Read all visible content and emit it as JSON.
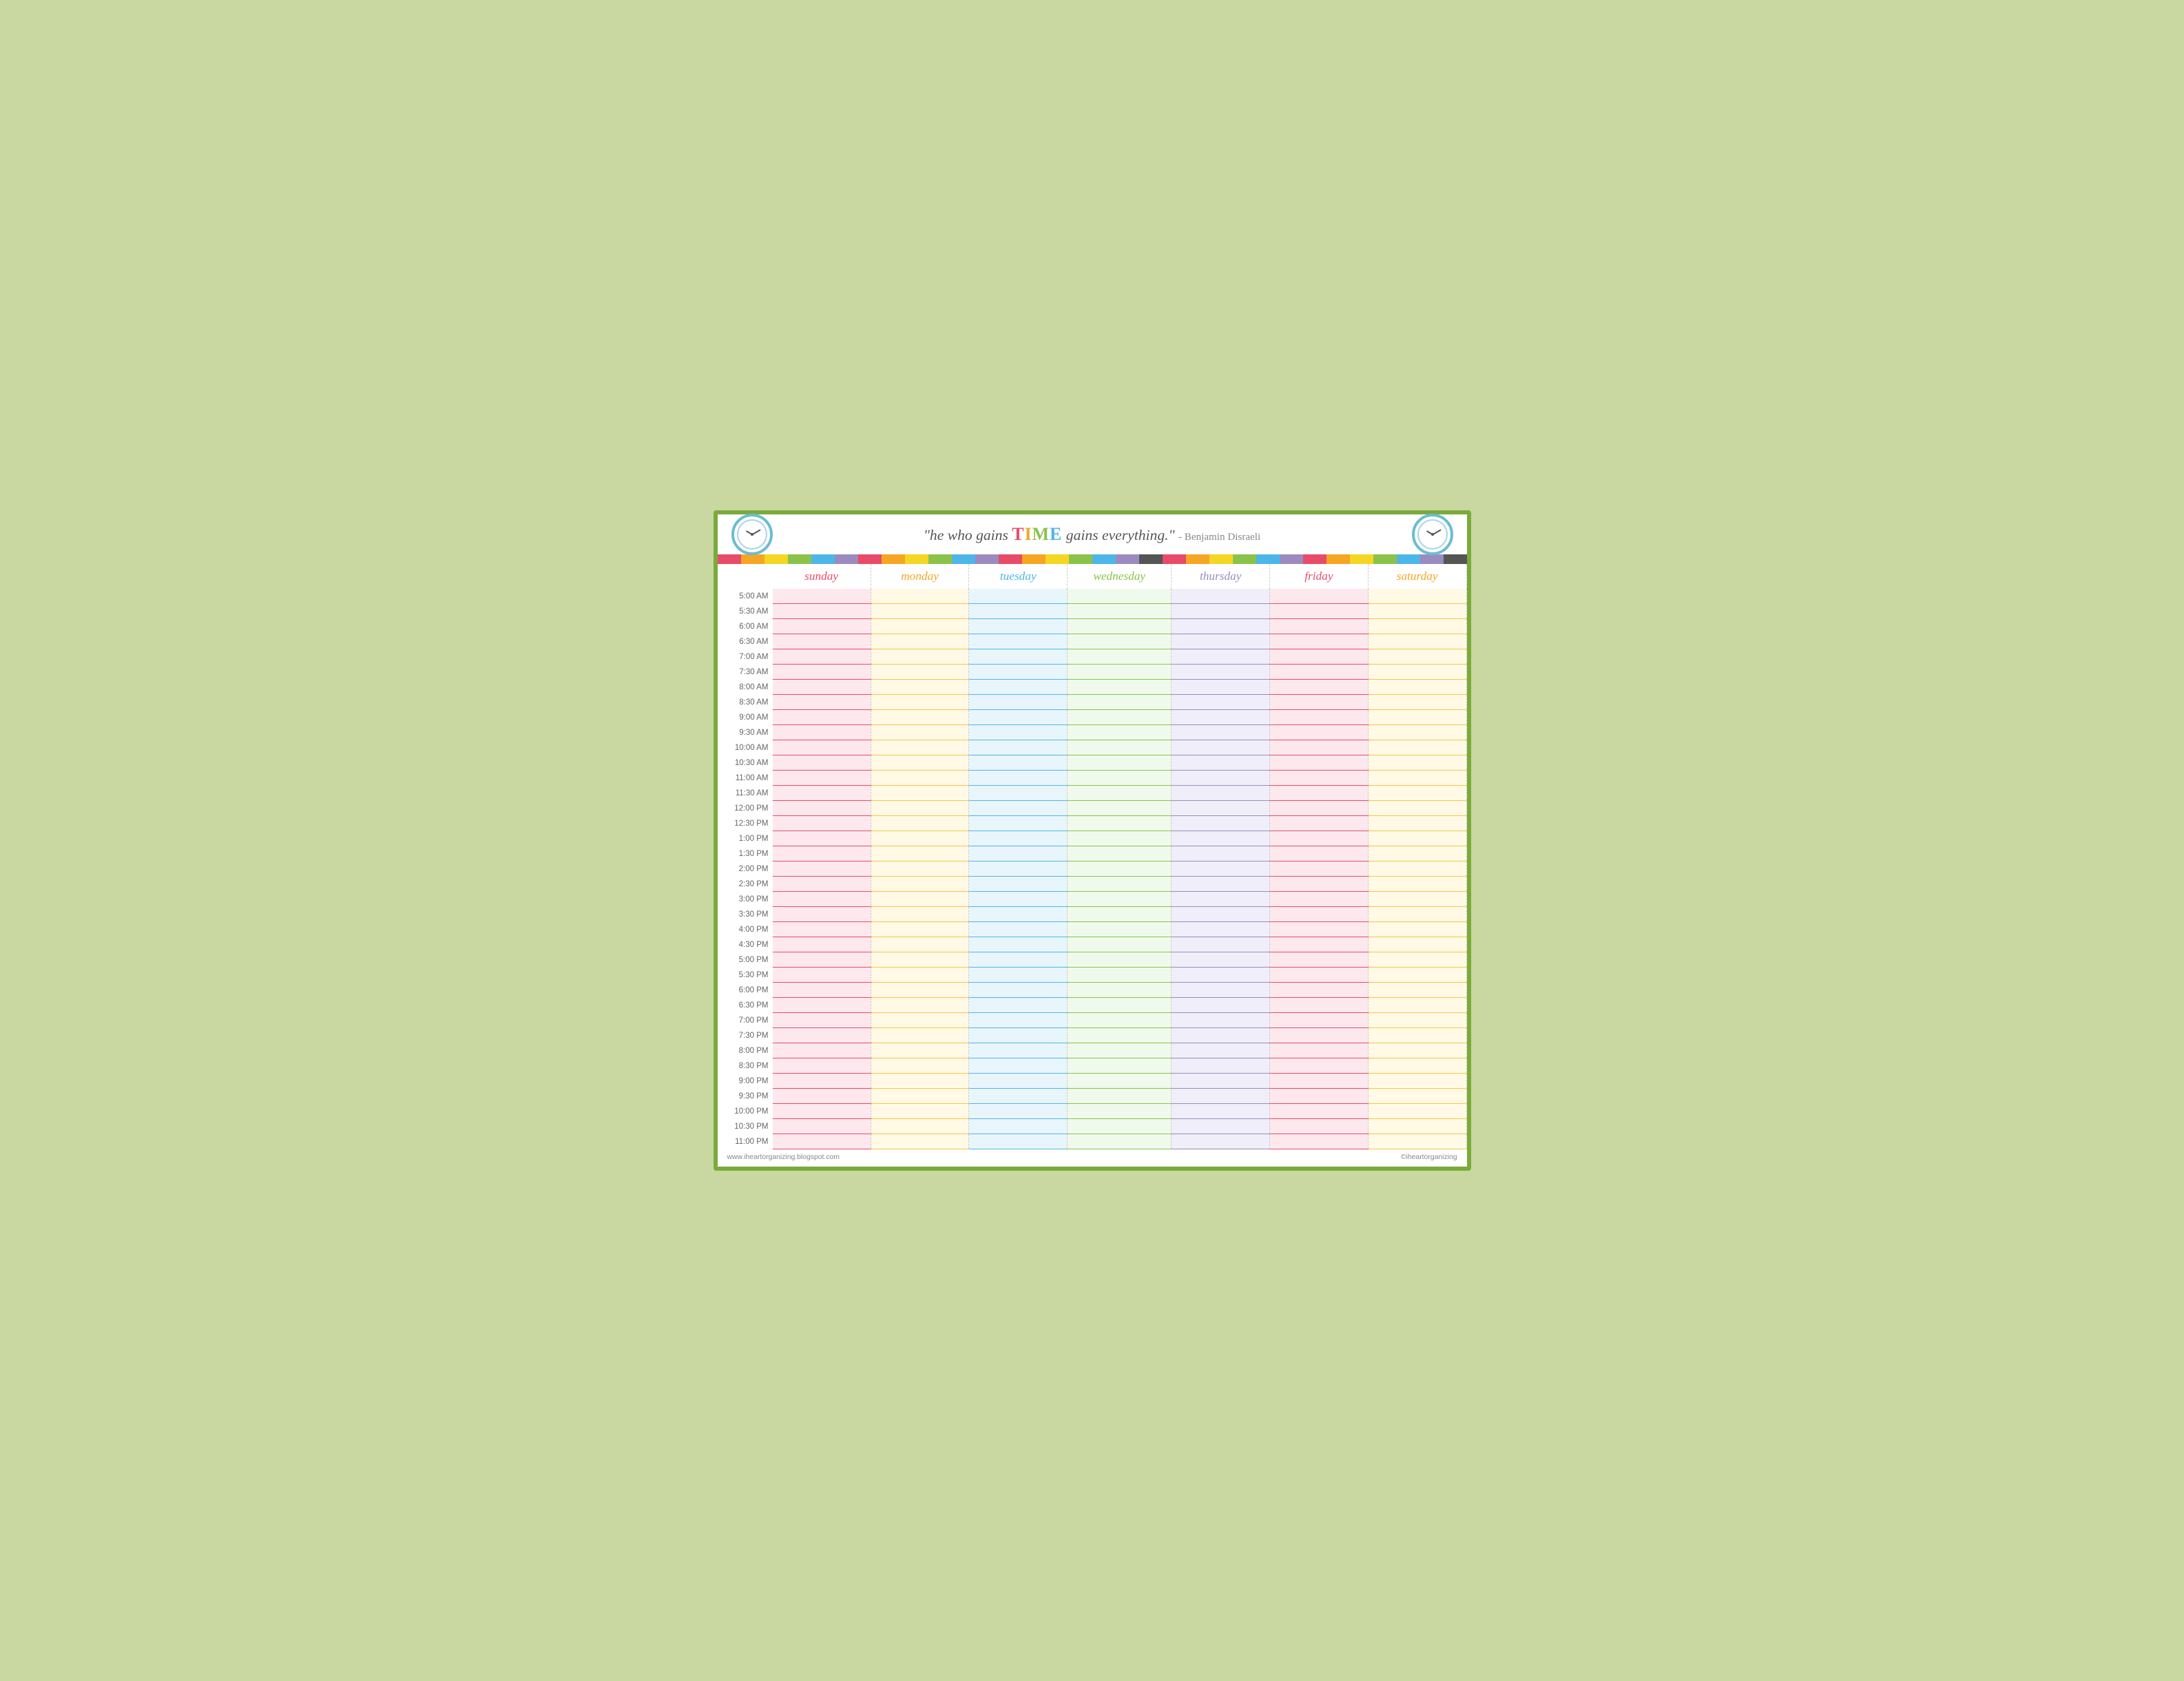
{
  "header": {
    "quote_before": "\"he who gains ",
    "quote_time": "TIME",
    "quote_after": " gains everything.\"",
    "attribution": "- Benjamin Disraeli"
  },
  "days": {
    "sunday": "sunday",
    "monday": "monday",
    "tuesday": "tuesday",
    "wednesday": "wednesday",
    "thursday": "thursday",
    "friday": "friday",
    "saturday": "saturday"
  },
  "times": [
    "5:00 AM",
    "5:30 AM",
    "6:00 AM",
    "6:30 AM",
    "7:00 AM",
    "7:30 AM",
    "8:00 AM",
    "8:30 AM",
    "9:00 AM",
    "9:30 AM",
    "10:00 AM",
    "10:30 AM",
    "11:00 AM",
    "11:30 AM",
    "12:00 PM",
    "12:30 PM",
    "1:00 PM",
    "1:30 PM",
    "2:00 PM",
    "2:30 PM",
    "3:00 PM",
    "3:30 PM",
    "4:00 PM",
    "4:30 PM",
    "5:00 PM",
    "5:30 PM",
    "6:00 PM",
    "6:30 PM",
    "7:00 PM",
    "7:30 PM",
    "8:00 PM",
    "8:30 PM",
    "9:00 PM",
    "9:30 PM",
    "10:00 PM",
    "10:30 PM",
    "11:00 PM"
  ],
  "rainbow_colors": [
    "#e84b6a",
    "#f5a623",
    "#f5d623",
    "#8bc34a",
    "#4db6e8",
    "#9b8bbf",
    "#e84b6a",
    "#f5a623",
    "#f5d623",
    "#8bc34a",
    "#4db6e8",
    "#9b8bbf",
    "#e84b6a",
    "#f5a623",
    "#f5d623",
    "#8bc34a",
    "#4db6e8",
    "#9b8bbf",
    "#555555",
    "#e84b6a",
    "#f5a623",
    "#f5d623",
    "#8bc34a",
    "#4db6e8",
    "#9b8bbf",
    "#e84b6a",
    "#f5a623",
    "#f5d623",
    "#8bc34a",
    "#4db6e8",
    "#9b8bbf",
    "#555555"
  ],
  "footer": {
    "left": "www.iheartorganizing.blogspot.com",
    "right": "©iheartorganizing"
  }
}
